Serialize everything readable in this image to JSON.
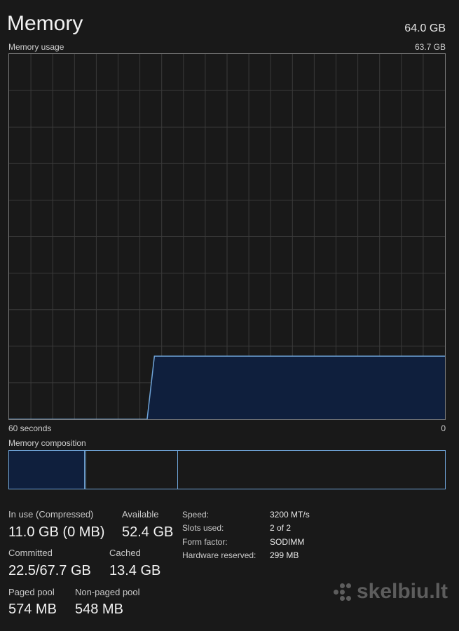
{
  "header": {
    "title": "Memory",
    "total": "64.0 GB"
  },
  "usage_graph": {
    "label": "Memory usage",
    "max_label": "63.7 GB",
    "time_left": "60 seconds",
    "time_right": "0",
    "fill_color": "#0f1f3d",
    "line_color": "#6fa4d8",
    "grid_color": "#3a3a3a"
  },
  "chart_data": {
    "type": "area",
    "xlabel": "",
    "ylabel": "",
    "x": [
      60,
      41,
      40,
      0
    ],
    "values": [
      0,
      0,
      11.0,
      11.0
    ],
    "xlim": [
      60,
      0
    ],
    "ylim": [
      0,
      63.7
    ],
    "grid": true
  },
  "composition": {
    "label": "Memory composition",
    "in_use_gb": 11.0,
    "modified_gb": 0.2,
    "standby_gb": 13.4,
    "total_gb": 63.7
  },
  "stats": {
    "in_use_label": "In use (Compressed)",
    "in_use_value": "11.0 GB (0 MB)",
    "available_label": "Available",
    "available_value": "52.4 GB",
    "committed_label": "Committed",
    "committed_value": "22.5/67.7 GB",
    "cached_label": "Cached",
    "cached_value": "13.4 GB",
    "paged_label": "Paged pool",
    "paged_value": "574 MB",
    "nonpaged_label": "Non-paged pool",
    "nonpaged_value": "548 MB"
  },
  "properties": [
    {
      "label": "Speed:",
      "value": "3200 MT/s"
    },
    {
      "label": "Slots used:",
      "value": "2 of 2"
    },
    {
      "label": "Form factor:",
      "value": "SODIMM"
    },
    {
      "label": "Hardware reserved:",
      "value": "299 MB"
    }
  ],
  "watermark": {
    "text": "skelbiu.lt",
    "icon": "dots-logo-icon"
  }
}
